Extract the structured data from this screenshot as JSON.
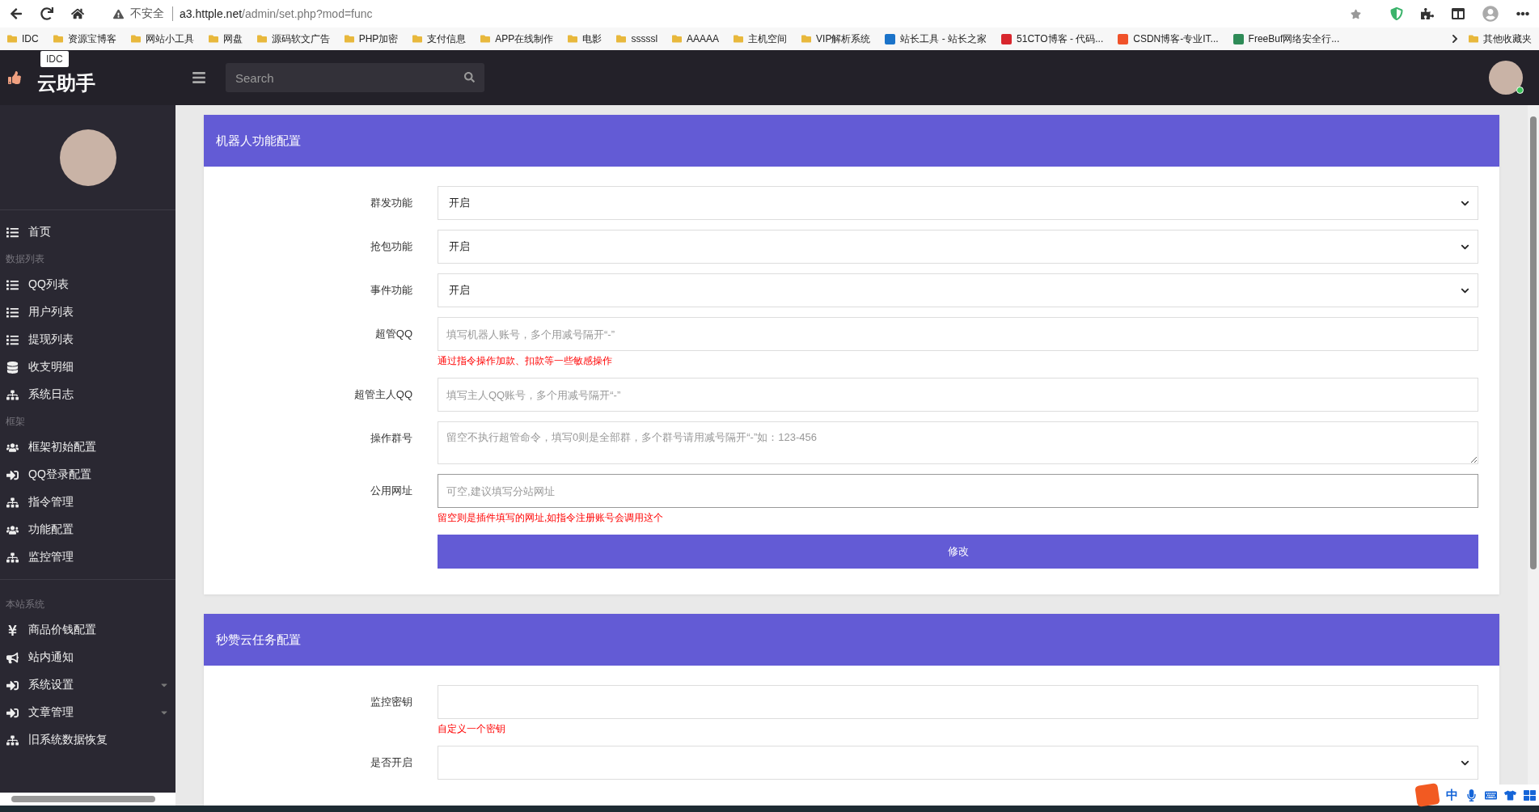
{
  "browser": {
    "security_label": "不安全",
    "url_host": "a3.httple.net",
    "url_path": "/admin/set.php?mod=func",
    "bookmarks": [
      {
        "label": "IDC",
        "kind": "folder"
      },
      {
        "label": "资源宝博客",
        "kind": "folder"
      },
      {
        "label": "网站小工具",
        "kind": "folder"
      },
      {
        "label": "网盘",
        "kind": "folder"
      },
      {
        "label": "源码软文广告",
        "kind": "folder"
      },
      {
        "label": "PHP加密",
        "kind": "folder"
      },
      {
        "label": "支付信息",
        "kind": "folder"
      },
      {
        "label": "APP在线制作",
        "kind": "folder"
      },
      {
        "label": "电影",
        "kind": "folder"
      },
      {
        "label": "sssssl",
        "kind": "folder"
      },
      {
        "label": "AAAAA",
        "kind": "folder"
      },
      {
        "label": "主机空间",
        "kind": "folder"
      },
      {
        "label": "VIP解析系统",
        "kind": "folder"
      },
      {
        "label": "站长工具 - 站长之家",
        "kind": "site",
        "color": "#1a73c9"
      },
      {
        "label": "51CTO博客 - 代码...",
        "kind": "site",
        "color": "#d8262d"
      },
      {
        "label": "CSDN博客-专业IT...",
        "kind": "site",
        "color": "#f0522a"
      },
      {
        "label": "FreeBuf网络安全行...",
        "kind": "site",
        "color": "#2e8b57"
      }
    ],
    "other_bookmarks": "其他收藏夹"
  },
  "header": {
    "logo_text": "云助手",
    "tooltip": "IDC",
    "search_placeholder": "Search"
  },
  "sidebar": {
    "sections": [
      {
        "items": [
          {
            "label": "首页",
            "kind": "link"
          }
        ]
      },
      {
        "title": "数据列表",
        "items": [
          {
            "label": "QQ列表",
            "kind": "link"
          },
          {
            "label": "用户列表",
            "kind": "link"
          },
          {
            "label": "提现列表",
            "kind": "link"
          },
          {
            "label": "收支明细",
            "kind": "link"
          },
          {
            "label": "系统日志",
            "kind": "link"
          }
        ]
      },
      {
        "title": "框架",
        "items": [
          {
            "label": "框架初始配置",
            "kind": "link"
          },
          {
            "label": "QQ登录配置",
            "kind": "link"
          },
          {
            "label": "指令管理",
            "kind": "link"
          },
          {
            "label": "功能配置",
            "kind": "link"
          },
          {
            "label": "监控管理",
            "kind": "link"
          }
        ]
      },
      {
        "title": "本站系统",
        "items": [
          {
            "label": "商品价钱配置",
            "kind": "link"
          },
          {
            "label": "站内通知",
            "kind": "link"
          },
          {
            "label": "系统设置",
            "kind": "submenu"
          },
          {
            "label": "文章管理",
            "kind": "submenu"
          },
          {
            "label": "旧系统数据恢复",
            "kind": "link"
          }
        ]
      }
    ]
  },
  "cards": [
    {
      "title": "机器人功能配置",
      "fields": [
        {
          "label": "群发功能",
          "kind": "select",
          "value": "开启"
        },
        {
          "label": "抢包功能",
          "kind": "select",
          "value": "开启"
        },
        {
          "label": "事件功能",
          "kind": "select",
          "value": "开启"
        },
        {
          "label": "超管QQ",
          "kind": "input",
          "placeholder": "填写机器人账号，多个用减号隔开“-”",
          "hint": "通过指令操作加款、扣款等一些敏感操作"
        },
        {
          "label": "超管主人QQ",
          "kind": "input",
          "placeholder": "填写主人QQ账号，多个用减号隔开“-”"
        },
        {
          "label": "操作群号",
          "kind": "textarea",
          "placeholder": "留空不执行超管命令，填写0则是全部群，多个群号请用减号隔开“-”如：123-456"
        },
        {
          "label": "公用网址",
          "kind": "input",
          "placeholder": "可空,建议填写分站网址",
          "focused": true,
          "hint": "留空则是插件填写的网址,如指令注册账号会调用这个"
        }
      ],
      "button": "修改"
    },
    {
      "title": "秒赞云任务配置",
      "fields": [
        {
          "label": "监控密钥",
          "kind": "input",
          "hint": "自定义一个密钥"
        },
        {
          "label": "是否开启",
          "kind": "select"
        }
      ]
    }
  ],
  "ime": {
    "mode": "中"
  }
}
